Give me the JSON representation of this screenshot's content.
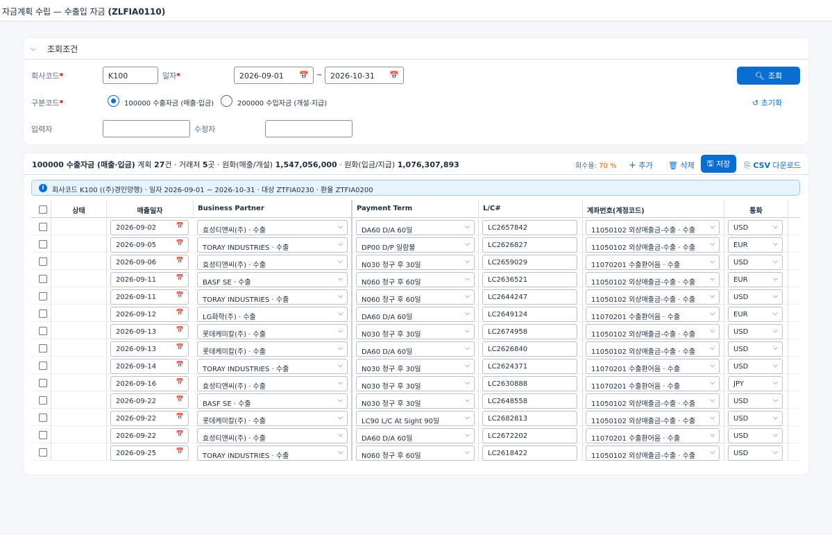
{
  "app": {
    "title_prefix": "자금계획 수립 — 수출입 자금",
    "title_code": "(ZLFIA0110)"
  },
  "filter": {
    "section_title": "조회조건",
    "company_label": "회사코드",
    "company_value": "K100",
    "date_label": "일자",
    "date_from": "2026-09-01",
    "date_sep": "~",
    "date_to": "2026-10-31",
    "division_label": "구분코드",
    "radio_export": "100000 수출자금 (매출·입금)",
    "radio_import": "200000 수입자금 (개설·지급)",
    "creator_label": "입력자",
    "creator_value": "",
    "modifier_label": "수정자",
    "modifier_value": "",
    "search_button": "조회",
    "reset_button": "초기화",
    "required_mark": "*"
  },
  "result": {
    "heading": "100000 수출자금 (매출·입금)",
    "summary_prefix": "계획",
    "plan_count": "27",
    "summary_mid1": "건 · 거래처",
    "partner_count": "5",
    "summary_mid2": "곳 · 원화(매출/개설)",
    "sales_total": "1,547,056,000",
    "summary_mid3": "· 원화(입금/지급)",
    "receipt_total": "1,076,307,893",
    "collection_label": "회수율:",
    "collection_rate": "70 %",
    "add_button": "추가",
    "delete_button": "삭제",
    "save_button": "저장",
    "csv_bold": "CSV",
    "csv_rest": "다운로드",
    "info_text": "회사코드 K100 ((주)경인양행) · 일자 2026-09-01 ~ 2026-10-31 · 대상 ZTFIA0230 · 환율 ZTFIA0200"
  },
  "table": {
    "columns": [
      "상태",
      "매출일자",
      "Business Partner",
      "Payment Term",
      "L/C#",
      "계좌번호(계정코드)",
      "통화"
    ],
    "rows": [
      {
        "date": "2026-09-02",
        "partner": "효성티앤씨(주) · 수출",
        "term": "DA60 D/A 60일",
        "lc": "LC2657842",
        "account": "11050102 외상매출금-수출 · 수출",
        "currency": "USD"
      },
      {
        "date": "2026-09-05",
        "partner": "TORAY INDUSTRIES · 수출",
        "term": "DP00 D/P 일람불",
        "lc": "LC2626827",
        "account": "11050102 외상매출금-수출 · 수출",
        "currency": "EUR"
      },
      {
        "date": "2026-09-06",
        "partner": "효성티앤씨(주) · 수출",
        "term": "N030 청구 후 30일",
        "lc": "LC2659029",
        "account": "11070201 수출환어음 · 수출",
        "currency": "USD"
      },
      {
        "date": "2026-09-11",
        "partner": "BASF SE · 수출",
        "term": "N060 청구 후 60일",
        "lc": "LC2636521",
        "account": "11050102 외상매출금-수출 · 수출",
        "currency": "EUR"
      },
      {
        "date": "2026-09-11",
        "partner": "TORAY INDUSTRIES · 수출",
        "term": "N060 청구 후 60일",
        "lc": "LC2644247",
        "account": "11050102 외상매출금-수출 · 수출",
        "currency": "USD"
      },
      {
        "date": "2026-09-12",
        "partner": "LG화학(주) · 수출",
        "term": "DA60 D/A 60일",
        "lc": "LC2649124",
        "account": "11070201 수출환어음 · 수출",
        "currency": "EUR"
      },
      {
        "date": "2026-09-13",
        "partner": "롯데케미칼(주) · 수출",
        "term": "N030 청구 후 30일",
        "lc": "LC2674958",
        "account": "11050102 외상매출금-수출 · 수출",
        "currency": "USD"
      },
      {
        "date": "2026-09-13",
        "partner": "롯데케미칼(주) · 수출",
        "term": "DA60 D/A 60일",
        "lc": "LC2626840",
        "account": "11050102 외상매출금-수출 · 수출",
        "currency": "USD"
      },
      {
        "date": "2026-09-14",
        "partner": "TORAY INDUSTRIES · 수출",
        "term": "N030 청구 후 30일",
        "lc": "LC2624371",
        "account": "11070201 수출환어음 · 수출",
        "currency": "USD"
      },
      {
        "date": "2026-09-16",
        "partner": "효성티앤씨(주) · 수출",
        "term": "N030 청구 후 30일",
        "lc": "LC2630888",
        "account": "11070201 수출환어음 · 수출",
        "currency": "JPY"
      },
      {
        "date": "2026-09-22",
        "partner": "BASF SE · 수출",
        "term": "N030 청구 후 30일",
        "lc": "LC2648558",
        "account": "11050102 외상매출금-수출 · 수출",
        "currency": "USD"
      },
      {
        "date": "2026-09-22",
        "partner": "롯데케미칼(주) · 수출",
        "term": "LC90 L/C At Sight 90일",
        "lc": "LC2682813",
        "account": "11050102 외상매출금-수출 · 수출",
        "currency": "USD"
      },
      {
        "date": "2026-09-22",
        "partner": "효성티앤씨(주) · 수출",
        "term": "DA60 D/A 60일",
        "lc": "LC2672202",
        "account": "11070201 수출환어음 · 수출",
        "currency": "USD"
      },
      {
        "date": "2026-09-25",
        "partner": "TORAY INDUSTRIES · 수출",
        "term": "N060 청구 후 60일",
        "lc": "LC2618422",
        "account": "11050102 외상매출금-수출 · 수출",
        "currency": "USD"
      }
    ]
  },
  "colors": {
    "accent": "#0a6ed1",
    "required": "#bb0000",
    "rate": "#e76500",
    "info_bg": "#e8f4fb"
  }
}
